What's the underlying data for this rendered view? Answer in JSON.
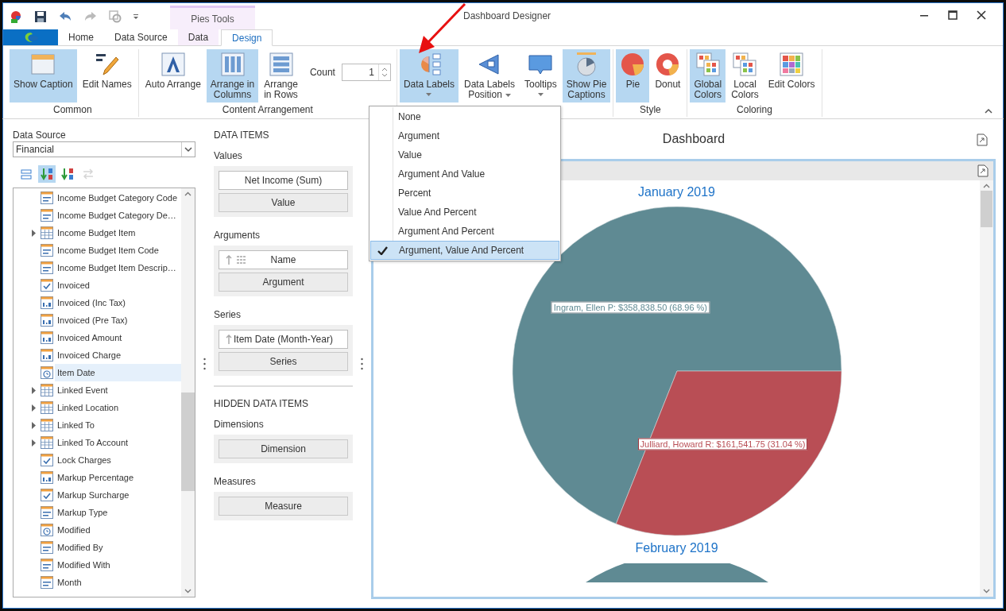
{
  "window": {
    "title": "Dashboard Designer"
  },
  "contextual_tab_group": "Pies Tools",
  "tabs": [
    {
      "label": "Home",
      "selected": false,
      "contextual": false
    },
    {
      "label": "Data Source",
      "selected": false,
      "contextual": false
    },
    {
      "label": "Data",
      "selected": false,
      "contextual": true
    },
    {
      "label": "Design",
      "selected": true,
      "contextual": true
    }
  ],
  "ribbon": {
    "groups": [
      {
        "caption": "Common",
        "items": [
          {
            "kind": "button",
            "label": "Show Caption",
            "selected": true,
            "dropdown": false
          },
          {
            "kind": "button",
            "label": "Edit Names",
            "selected": false,
            "dropdown": false
          }
        ]
      },
      {
        "caption": "Content Arrangement",
        "items": [
          {
            "kind": "button",
            "label": "Auto Arrange",
            "selected": false,
            "dropdown": false
          },
          {
            "kind": "button",
            "label": "Arrange in\nColumns",
            "selected": true,
            "dropdown": false
          },
          {
            "kind": "button",
            "label": "Arrange\nin Rows",
            "selected": false,
            "dropdown": false
          },
          {
            "kind": "spinner",
            "label": "Count",
            "value": "1"
          }
        ]
      },
      {
        "items": [
          {
            "kind": "button",
            "label": "Data Labels",
            "selected": true,
            "dropdown": true
          },
          {
            "kind": "button",
            "label": "Data Labels\nPosition",
            "selected": false,
            "dropdown": true
          },
          {
            "kind": "button",
            "label": "Tooltips",
            "selected": false,
            "dropdown": true
          },
          {
            "kind": "button",
            "label": "Show Pie\nCaptions",
            "selected": true,
            "dropdown": false
          }
        ]
      },
      {
        "caption": "Style",
        "items": [
          {
            "kind": "button",
            "label": "Pie",
            "selected": true,
            "dropdown": false
          },
          {
            "kind": "button",
            "label": "Donut",
            "selected": false,
            "dropdown": false
          }
        ]
      },
      {
        "caption": "Coloring",
        "items": [
          {
            "kind": "button",
            "label": "Global\nColors",
            "selected": true,
            "dropdown": false
          },
          {
            "kind": "button",
            "label": "Local\nColors",
            "selected": false,
            "dropdown": false
          },
          {
            "kind": "button",
            "label": "Edit Colors",
            "selected": false,
            "dropdown": false
          }
        ]
      }
    ]
  },
  "data_labels_menu": [
    {
      "label": "None",
      "selected": false
    },
    {
      "label": "Argument",
      "selected": false
    },
    {
      "label": "Value",
      "selected": false
    },
    {
      "label": "Argument And Value",
      "selected": false
    },
    {
      "label": "Percent",
      "selected": false
    },
    {
      "label": "Value And Percent",
      "selected": false
    },
    {
      "label": "Argument And Percent",
      "selected": false
    },
    {
      "label": "Argument, Value And Percent",
      "selected": true
    }
  ],
  "data_source": {
    "label": "Data Source",
    "value": "Financial"
  },
  "field_toolbar": [
    {
      "selected": false,
      "disabled": false
    },
    {
      "selected": true,
      "disabled": false
    },
    {
      "selected": false,
      "disabled": false
    },
    {
      "selected": false,
      "disabled": true
    }
  ],
  "fields": [
    {
      "name": "Income Budget Category Code",
      "kind": "text",
      "expandable": false,
      "selected": false
    },
    {
      "name": "Income Budget Category De…",
      "kind": "text",
      "expandable": false,
      "selected": false
    },
    {
      "name": "Income Budget Item",
      "kind": "table",
      "expandable": true,
      "selected": false
    },
    {
      "name": "Income Budget Item Code",
      "kind": "text",
      "expandable": false,
      "selected": false
    },
    {
      "name": "Income Budget Item Descrip…",
      "kind": "text",
      "expandable": false,
      "selected": false
    },
    {
      "name": "Invoiced",
      "kind": "bool",
      "expandable": false,
      "selected": false
    },
    {
      "name": "Invoiced (Inc Tax)",
      "kind": "number",
      "expandable": false,
      "selected": false
    },
    {
      "name": "Invoiced (Pre Tax)",
      "kind": "number",
      "expandable": false,
      "selected": false
    },
    {
      "name": "Invoiced Amount",
      "kind": "number",
      "expandable": false,
      "selected": false
    },
    {
      "name": "Invoiced Charge",
      "kind": "number",
      "expandable": false,
      "selected": false
    },
    {
      "name": "Item Date",
      "kind": "date",
      "expandable": false,
      "selected": true
    },
    {
      "name": "Linked Event",
      "kind": "table",
      "expandable": true,
      "selected": false
    },
    {
      "name": "Linked Location",
      "kind": "table",
      "expandable": true,
      "selected": false
    },
    {
      "name": "Linked To",
      "kind": "table",
      "expandable": true,
      "selected": false
    },
    {
      "name": "Linked To Account",
      "kind": "table",
      "expandable": true,
      "selected": false
    },
    {
      "name": "Lock Charges",
      "kind": "bool",
      "expandable": false,
      "selected": false
    },
    {
      "name": "Markup Percentage",
      "kind": "number",
      "expandable": false,
      "selected": false
    },
    {
      "name": "Markup Surcharge",
      "kind": "bool",
      "expandable": false,
      "selected": false
    },
    {
      "name": "Markup Type",
      "kind": "text",
      "expandable": false,
      "selected": false
    },
    {
      "name": "Modified",
      "kind": "date",
      "expandable": false,
      "selected": false
    },
    {
      "name": "Modified By",
      "kind": "text",
      "expandable": false,
      "selected": false
    },
    {
      "name": "Modified With",
      "kind": "text",
      "expandable": false,
      "selected": false
    },
    {
      "name": "Month",
      "kind": "text",
      "expandable": false,
      "selected": false
    }
  ],
  "data_items": {
    "title": "DATA ITEMS",
    "sections": [
      {
        "label": "Values",
        "items": [
          {
            "text": "Net Income (Sum)",
            "kind": "bound",
            "sort": false,
            "grip": false
          },
          {
            "text": "Value",
            "kind": "empty",
            "sort": false,
            "grip": false
          }
        ]
      },
      {
        "label": "Arguments",
        "items": [
          {
            "text": "Name",
            "kind": "bound",
            "sort": true,
            "grip": true
          },
          {
            "text": "Argument",
            "kind": "empty",
            "sort": false,
            "grip": false
          }
        ]
      },
      {
        "label": "Series",
        "items": [
          {
            "text": "Item Date (Month-Year)",
            "kind": "bound",
            "sort": true,
            "grip": false
          },
          {
            "text": "Series",
            "kind": "empty",
            "sort": false,
            "grip": false
          }
        ]
      }
    ]
  },
  "hidden_data_items": {
    "title": "HIDDEN DATA ITEMS",
    "sections": [
      {
        "label": "Dimensions",
        "items": [
          {
            "text": "Dimension",
            "kind": "empty",
            "sort": false,
            "grip": false
          }
        ]
      },
      {
        "label": "Measures",
        "items": [
          {
            "text": "Measure",
            "kind": "empty",
            "sort": false,
            "grip": false
          }
        ]
      }
    ]
  },
  "dashboard": {
    "title": "Dashboard",
    "pies": [
      {
        "caption": "January 2019",
        "chart_data": {
          "type": "pie",
          "values": [
            68.96,
            31.04
          ],
          "value_labels": [
            "Ingram, Ellen P: $358,838.50 (68.96 %)",
            "Julliard, Howard R: $161,541.75 (31.04 %)"
          ]
        }
      },
      {
        "caption": "February 2019"
      }
    ]
  }
}
